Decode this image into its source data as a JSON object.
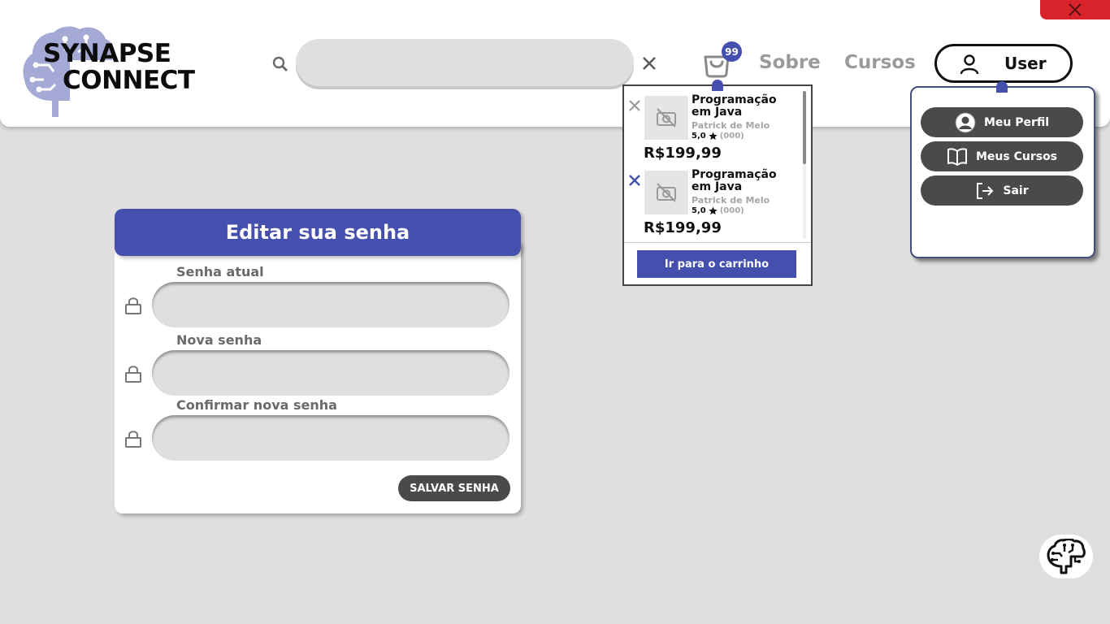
{
  "app": {
    "logo_line1": "SYNAPSE",
    "logo_line2": "CONNECT",
    "brand_color": "#4550ae"
  },
  "header": {
    "search": {
      "value": "",
      "placeholder": ""
    },
    "cart_count": "99",
    "nav": {
      "about": "Sobre",
      "courses": "Cursos"
    },
    "user_label": "User"
  },
  "cart": {
    "items": [
      {
        "title": "Programação em Java",
        "author": "Patrick de Melo",
        "rating": "5,0",
        "reviews": "(000)",
        "price": "R$199,99"
      },
      {
        "title": "Programação em Java",
        "author": "Patrick de Melo",
        "rating": "5,0",
        "reviews": "(000)",
        "price": "R$199,99"
      }
    ],
    "go_label": "Ir para o carrinho"
  },
  "user_menu": {
    "profile": "Meu Perfil",
    "my_courses": "Meus Cursos",
    "logout": "Sair"
  },
  "form": {
    "title": "Editar sua senha",
    "fields": [
      {
        "label": "Senha atual"
      },
      {
        "label": "Nova senha"
      },
      {
        "label": "Confirmar nova senha"
      }
    ],
    "save_label": "SALVAR SENHA"
  },
  "icons": [
    "close-icon",
    "search-icon",
    "cart-icon",
    "user-icon",
    "no-image-icon",
    "star-icon",
    "book-icon",
    "logout-icon",
    "lock-icon",
    "brain-icon"
  ]
}
